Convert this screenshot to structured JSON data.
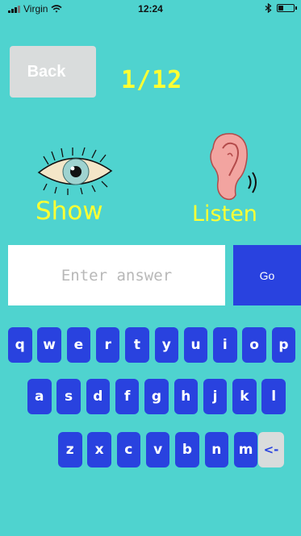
{
  "status": {
    "carrier": "Virgin",
    "time": "12:24",
    "battery_level": 0.3
  },
  "header": {
    "back_label": "Back",
    "progress_text": "1/12"
  },
  "modes": {
    "show_label": "Show",
    "listen_label": "Listen"
  },
  "answer": {
    "placeholder": "Enter answer",
    "value": "",
    "go_label": "Go"
  },
  "keyboard": {
    "row1": [
      "q",
      "w",
      "e",
      "r",
      "t",
      "y",
      "u",
      "i",
      "o",
      "p"
    ],
    "row2": [
      "a",
      "s",
      "d",
      "f",
      "g",
      "h",
      "j",
      "k",
      "l"
    ],
    "row3": [
      "z",
      "x",
      "c",
      "v",
      "b",
      "n",
      "m"
    ],
    "backspace_label": "<-"
  },
  "colors": {
    "background": "#4fd3cf",
    "accent": "#2942df",
    "highlight": "#ffff33"
  },
  "icons": {
    "eye": "eye-icon",
    "ear": "ear-icon"
  }
}
